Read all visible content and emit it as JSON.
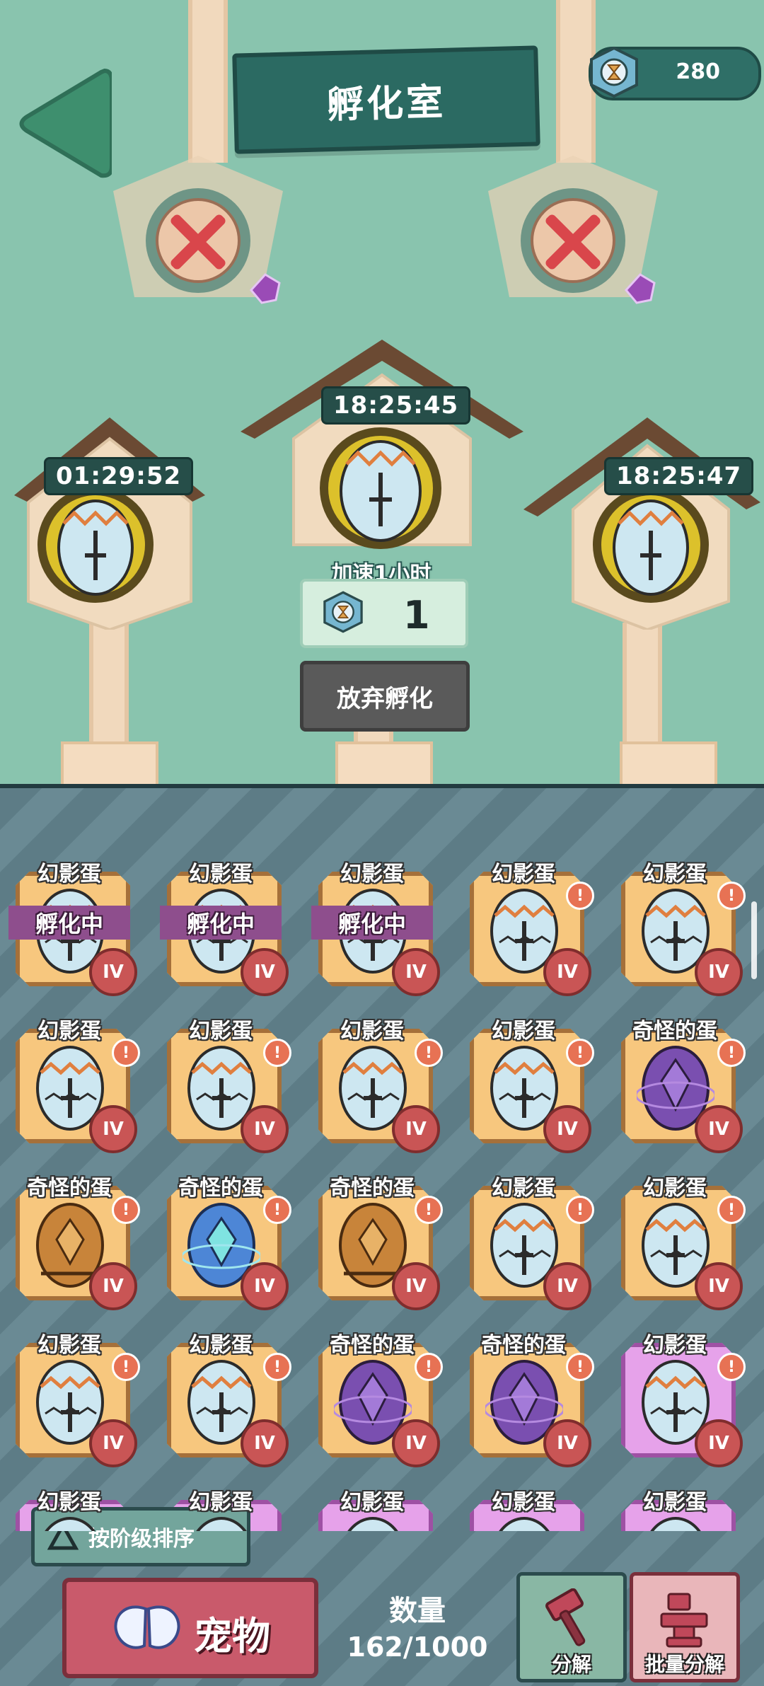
{
  "header": {
    "title": "孵化室",
    "currency_value": "280"
  },
  "slots": [
    {
      "timer": "01:29:52"
    },
    {
      "timer": "18:25:45"
    },
    {
      "timer": "18:25:47"
    }
  ],
  "speedup": {
    "label": "加速1小时",
    "cost": "1"
  },
  "abandon_label": "放弃孵化",
  "cards": [
    {
      "name": "幻影蛋",
      "egg": "phantom",
      "status": "孵化中",
      "tier": "IV",
      "alert": false
    },
    {
      "name": "幻影蛋",
      "egg": "phantom",
      "status": "孵化中",
      "tier": "IV",
      "alert": false
    },
    {
      "name": "幻影蛋",
      "egg": "phantom",
      "status": "孵化中",
      "tier": "IV",
      "alert": false
    },
    {
      "name": "幻影蛋",
      "egg": "phantom",
      "status": "",
      "tier": "IV",
      "alert": true
    },
    {
      "name": "幻影蛋",
      "egg": "phantom",
      "status": "",
      "tier": "IV",
      "alert": true
    },
    {
      "name": "幻影蛋",
      "egg": "phantom",
      "status": "",
      "tier": "IV",
      "alert": true
    },
    {
      "name": "幻影蛋",
      "egg": "phantom",
      "status": "",
      "tier": "IV",
      "alert": true
    },
    {
      "name": "幻影蛋",
      "egg": "phantom",
      "status": "",
      "tier": "IV",
      "alert": true
    },
    {
      "name": "幻影蛋",
      "egg": "phantom",
      "status": "",
      "tier": "IV",
      "alert": true
    },
    {
      "name": "奇怪的蛋",
      "egg": "purple",
      "status": "",
      "tier": "IV",
      "alert": true
    },
    {
      "name": "奇怪的蛋",
      "egg": "gold",
      "status": "",
      "tier": "IV",
      "alert": true
    },
    {
      "name": "奇怪的蛋",
      "egg": "blue",
      "status": "",
      "tier": "IV",
      "alert": true
    },
    {
      "name": "奇怪的蛋",
      "egg": "gold",
      "status": "",
      "tier": "IV",
      "alert": true
    },
    {
      "name": "幻影蛋",
      "egg": "phantom",
      "status": "",
      "tier": "IV",
      "alert": true
    },
    {
      "name": "幻影蛋",
      "egg": "phantom",
      "status": "",
      "tier": "IV",
      "alert": true
    },
    {
      "name": "幻影蛋",
      "egg": "phantom",
      "status": "",
      "tier": "IV",
      "alert": true
    },
    {
      "name": "幻影蛋",
      "egg": "phantom",
      "status": "",
      "tier": "IV",
      "alert": true
    },
    {
      "name": "奇怪的蛋",
      "egg": "purple",
      "status": "",
      "tier": "IV",
      "alert": true
    },
    {
      "name": "奇怪的蛋",
      "egg": "purple",
      "status": "",
      "tier": "IV",
      "alert": true
    },
    {
      "name": "幻影蛋",
      "egg": "phantom",
      "status": "",
      "tier": "IV",
      "alert": true,
      "highlight": true
    },
    {
      "name": "幻影蛋",
      "egg": "phantom",
      "status": "",
      "tier": "",
      "alert": false,
      "highlight": true
    },
    {
      "name": "幻影蛋",
      "egg": "phantom",
      "status": "",
      "tier": "",
      "alert": false,
      "highlight": true
    },
    {
      "name": "幻影蛋",
      "egg": "phantom",
      "status": "",
      "tier": "",
      "alert": false,
      "highlight": true
    },
    {
      "name": "幻影蛋",
      "egg": "phantom",
      "status": "",
      "tier": "",
      "alert": false,
      "highlight": true
    },
    {
      "name": "幻影蛋",
      "egg": "phantom",
      "status": "",
      "tier": "",
      "alert": false,
      "highlight": true
    }
  ],
  "footer": {
    "sort_label": "按阶级排序",
    "pet_label": "宠物",
    "count_label": "数量",
    "count_value": "162/1000",
    "disassemble_label": "分解",
    "bulk_disassemble_label": "批量分解"
  },
  "colors": {
    "bg_top": "#89c4ae",
    "board": "#2b6a62",
    "card": "#f7c77e",
    "tier": "#c95555",
    "hatching_band": "#8e4e8d"
  }
}
